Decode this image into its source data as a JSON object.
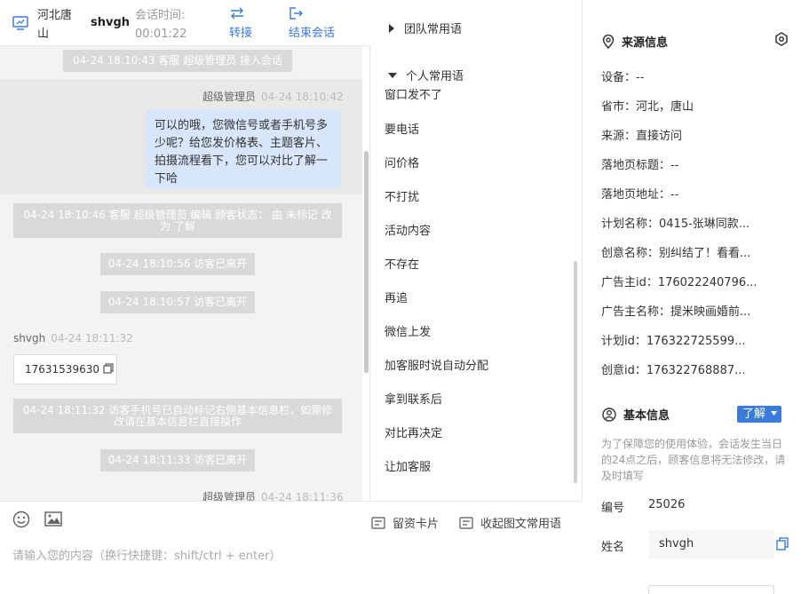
{
  "header": {
    "location": "河北唐山",
    "visitor_name": "shvgh",
    "session_label": "会话时间:",
    "session_time": "00:01:22",
    "transfer_label": "转接",
    "end_label": "结束会话",
    "accent": "#3a7bdc"
  },
  "messages": {
    "sys_join": "04-24 18:10:43 客服 超级管理员 接入会话",
    "agent_name": "超级管理员",
    "agent_time": "04-24 18:10:42",
    "agent_text": "可以的哦，您微信号或者手机号多少呢？给您发价格表、主题客片、拍摄流程看下，您可以对比了解一下哈",
    "sys_edit": "04-24 18:10:46 客服 超级管理员 编辑 顾客状态： 由 未标记 改为 了解",
    "sys_leave1": "04-24 18:10:56 访客已离开",
    "sys_leave2": "04-24 18:10:57 访客已离开",
    "visitor_name": "shvgh",
    "visitor_time": "04-24 18:11:32",
    "visitor_text": "17631539630",
    "sys_auto": "04-24 18:11:32 访客手机号已自动标记右侧基本信息栏，如需修改请在基本信息栏直接操作",
    "sys_leave3": "04-24 18:11:33 访客已离开",
    "agent_name2": "超级管理员",
    "agent_time2": "04-24 18:11:36"
  },
  "composer": {
    "card_label": "留资卡片",
    "collapse_label": "收起图文常用语",
    "placeholder": "请输入您的内容（换行快捷键：shift/ctrl + enter）"
  },
  "phrases": {
    "team_group": "团队常用语",
    "personal_group": "个人常用语",
    "items": [
      "窗口发不了",
      "要电话",
      "问价格",
      "不打扰",
      "活动内容",
      "不存在",
      "再追",
      "微信上发",
      "加客服时说自动分配",
      "拿到联系后",
      "对比再决定",
      "让加客服"
    ]
  },
  "source_info": {
    "title": "来源信息",
    "device": "设备：--",
    "province": "省市：河北，唐山",
    "source": "来源：直接访问",
    "landing_title": "落地页标题：--",
    "landing_url": "落地页地址：--",
    "plan_name": "计划名称：0415-张琳同款...",
    "creative_name": "创意名称：别纠结了！看看...",
    "advertiser_id": "广告主id：176022240796...",
    "advertiser_name": "广告主名称：提米映画婚前...",
    "plan_id": "计划id：176322725599...",
    "creative_id": "创意id：176322768887..."
  },
  "basic_info": {
    "title": "基本信息",
    "status_button": "了解",
    "hint": "为了保障您的使用体验，会话发生当日的24点之后，顾客信息将无法修改，请及时填写",
    "number_label": "编号",
    "number_value": "25026",
    "name_label": "姓名",
    "name_value": "shvgh"
  }
}
